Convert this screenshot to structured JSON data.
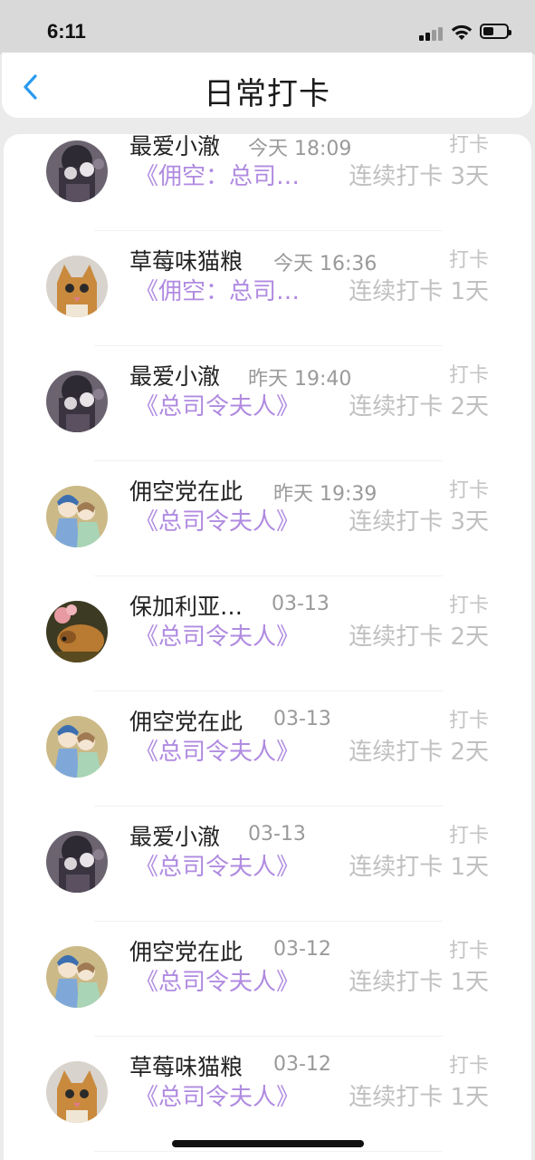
{
  "status_bar": {
    "time": "6:11"
  },
  "header": {
    "title": "日常打卡"
  },
  "colors": {
    "accent_blue": "#2a9bf0",
    "book_purple": "#b08be0"
  },
  "items": [
    {
      "name": "最爱小澈",
      "date": "今天 18:09",
      "action": "打卡",
      "book": "《佣空：总司…",
      "streak": "连续打卡 3天",
      "avatar": "dark-figure-avatar"
    },
    {
      "name": "草莓味猫粮",
      "date": "今天 16:36",
      "action": "打卡",
      "book": "《佣空：总司…",
      "streak": "连续打卡 1天",
      "avatar": "cat-avatar"
    },
    {
      "name": "最爱小澈",
      "date": "昨天 19:40",
      "action": "打卡",
      "book": "《总司令夫人》",
      "streak": "连续打卡 2天",
      "avatar": "dark-figure-avatar"
    },
    {
      "name": "佣空党在此",
      "date": "昨天 19:39",
      "action": "打卡",
      "book": "《总司令夫人》",
      "streak": "连续打卡 3天",
      "avatar": "anime-couple-avatar"
    },
    {
      "name": "保加利亚…",
      "date": "03-13",
      "action": "打卡",
      "book": "《总司令夫人》",
      "streak": "连续打卡 2天",
      "avatar": "dog-avatar"
    },
    {
      "name": "佣空党在此",
      "date": "03-13",
      "action": "打卡",
      "book": "《总司令夫人》",
      "streak": "连续打卡 2天",
      "avatar": "anime-couple-avatar"
    },
    {
      "name": "最爱小澈",
      "date": "03-13",
      "action": "打卡",
      "book": "《总司令夫人》",
      "streak": "连续打卡 1天",
      "avatar": "dark-figure-avatar"
    },
    {
      "name": "佣空党在此",
      "date": "03-12",
      "action": "打卡",
      "book": "《总司令夫人》",
      "streak": "连续打卡 1天",
      "avatar": "anime-couple-avatar"
    },
    {
      "name": "草莓味猫粮",
      "date": "03-12",
      "action": "打卡",
      "book": "《总司令夫人》",
      "streak": "连续打卡 1天",
      "avatar": "cat-avatar"
    }
  ]
}
